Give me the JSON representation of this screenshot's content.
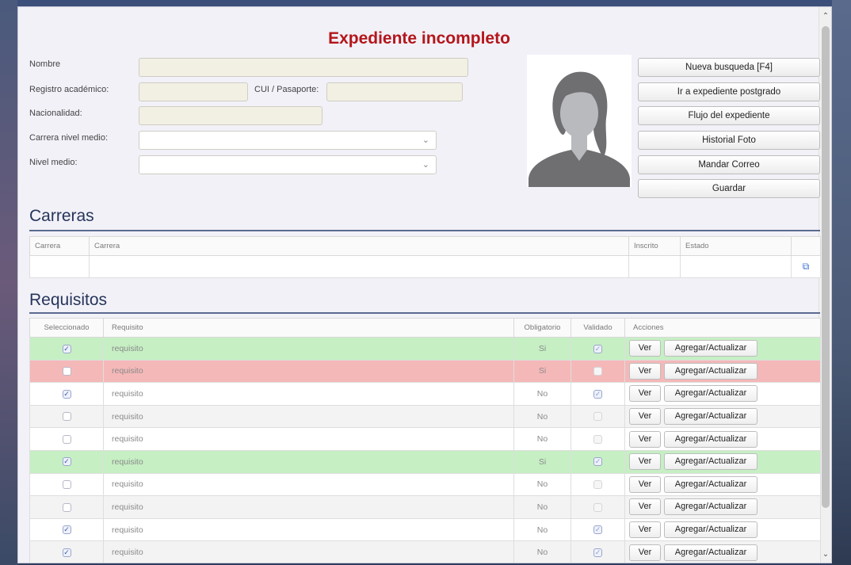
{
  "window": {
    "title": "Expediente incompleto"
  },
  "form": {
    "nombre_label": "Nombre",
    "registro_label": "Registro académico:",
    "cui_label": "CUI / Pasaporte:",
    "nacionalidad_label": "Nacionalidad:",
    "carrera_medio_label": "Carrera nivel medio:",
    "nivel_medio_label": "Nivel medio:"
  },
  "actions": {
    "nueva_busqueda": "Nueva busqueda [F4]",
    "ir_postgrado": "Ir a expediente postgrado",
    "flujo": "Flujo del expediente",
    "historial": "Historial Foto",
    "mandar_correo": "Mandar Correo",
    "guardar": "Guardar"
  },
  "carreras": {
    "title": "Carreras",
    "columns": [
      "Carrera",
      "Carrera",
      "Inscrito",
      "Estado",
      ""
    ]
  },
  "requisitos": {
    "title": "Requisitos",
    "columns": [
      "Seleccionado",
      "Requisito",
      "Obligatorio",
      "Validado",
      "Acciones"
    ],
    "ver_label": "Ver",
    "agregar_label": "Agregar/Actualizar",
    "rows": [
      {
        "selected": true,
        "name": "requisito",
        "obligatorio": "Si",
        "validado": true,
        "status": "ok"
      },
      {
        "selected": false,
        "name": "requisito",
        "obligatorio": "Si",
        "validado": false,
        "status": "bad"
      },
      {
        "selected": true,
        "name": "requisito",
        "obligatorio": "No",
        "validado": true,
        "status": "plain"
      },
      {
        "selected": false,
        "name": "requisito",
        "obligatorio": "No",
        "validado": false,
        "status": "alt"
      },
      {
        "selected": false,
        "name": "requisito",
        "obligatorio": "No",
        "validado": false,
        "status": "plain"
      },
      {
        "selected": true,
        "name": "requisito",
        "obligatorio": "Si",
        "validado": true,
        "status": "ok"
      },
      {
        "selected": false,
        "name": "requisito",
        "obligatorio": "No",
        "validado": false,
        "status": "plain"
      },
      {
        "selected": false,
        "name": "requisito",
        "obligatorio": "No",
        "validado": false,
        "status": "alt"
      },
      {
        "selected": true,
        "name": "requisito",
        "obligatorio": "No",
        "validado": true,
        "status": "plain"
      },
      {
        "selected": true,
        "name": "requisito",
        "obligatorio": "No",
        "validado": true,
        "status": "alt"
      }
    ]
  },
  "icons": {
    "avatar": "avatar-silhouette-icon",
    "dropdown": "chevron-down-icon",
    "copy": "copy-icon"
  },
  "colors": {
    "title": "#b4161b",
    "row_ok": "#c6efc4",
    "row_bad": "#f5b8b8",
    "section_rule": "#5b6a8e"
  }
}
